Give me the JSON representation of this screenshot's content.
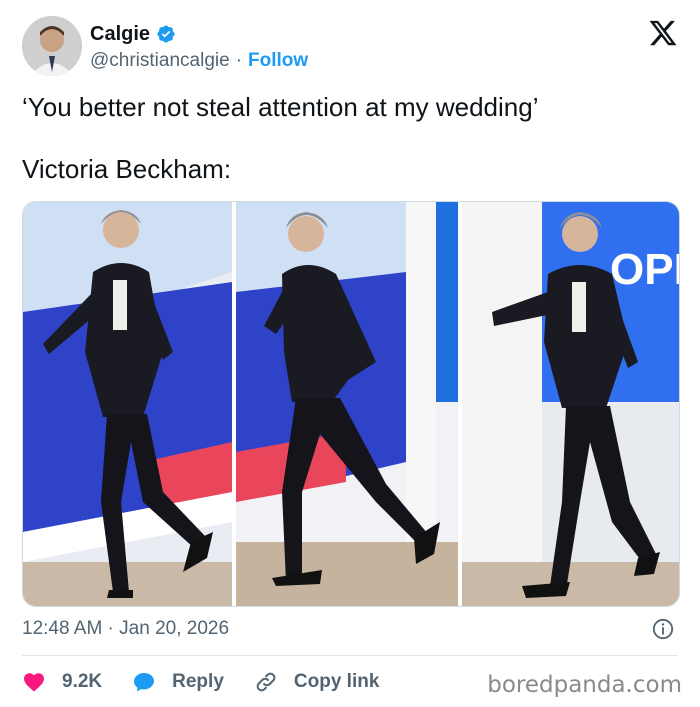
{
  "tweet": {
    "author_name": "Calgie",
    "author_handle": "@christiancalgie",
    "separator": "·",
    "follow_label": "Follow",
    "text_line1": "‘You better not steal attention at my wedding’",
    "text_line2": "Victoria Beckham:",
    "timestamp": "12:48 AM · Jan 20, 2026"
  },
  "actions": {
    "likes": "9.2K",
    "reply_label": "Reply",
    "copy_link_label": "Copy link"
  },
  "watermark": "boredpanda.com",
  "media_text": "OPP",
  "icons": {
    "verified": "verified-badge-icon",
    "x_logo": "x-logo-icon",
    "info": "info-icon",
    "heart": "heart-icon",
    "reply": "reply-bubble-icon",
    "link": "link-icon"
  },
  "colors": {
    "accent": "#1d9bf0",
    "like": "#f91880",
    "muted": "#536471",
    "text": "#0f1419"
  }
}
